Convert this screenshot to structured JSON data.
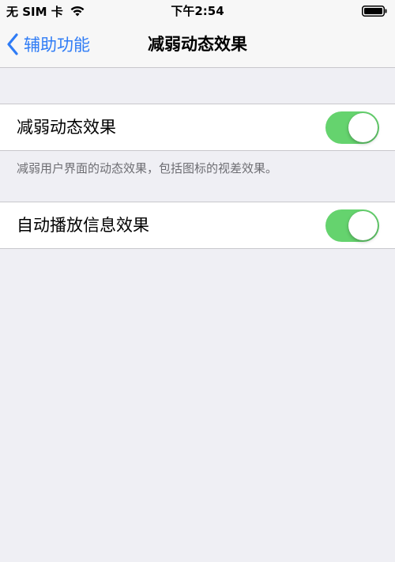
{
  "status_bar": {
    "carrier": "无 SIM 卡",
    "time": "下午2:54",
    "wifi_icon": "wifi-icon",
    "battery_icon": "battery-full-icon"
  },
  "nav": {
    "back_label": "辅助功能",
    "back_icon": "chevron-left-icon",
    "title": "减弱动态效果",
    "accent_color": "#2f7cf6"
  },
  "settings": {
    "reduce_motion": {
      "label": "减弱动态效果",
      "enabled": true,
      "footer": "减弱用户界面的动态效果，包括图标的视差效果。"
    },
    "auto_play_effects": {
      "label": "自动播放信息效果",
      "enabled": true
    },
    "toggle_on_color": "#65d36e"
  }
}
